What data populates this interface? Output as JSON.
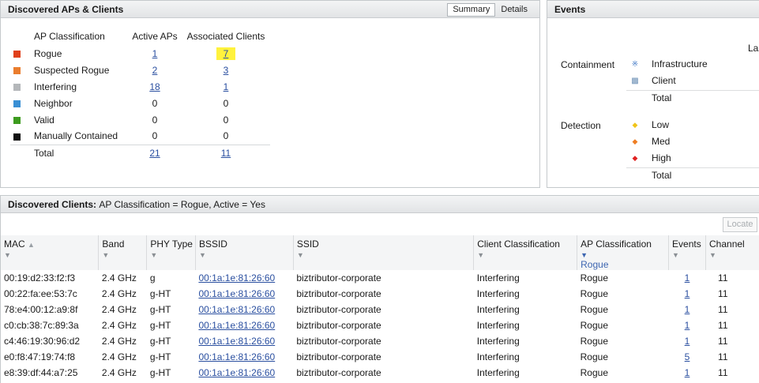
{
  "ap_panel": {
    "title": "Discovered APs & Clients",
    "tabs": [
      {
        "label": "Summary",
        "active": true
      },
      {
        "label": "Details",
        "active": false
      }
    ],
    "columns": [
      "AP Classification",
      "Active APs",
      "Associated Clients"
    ],
    "rows": [
      {
        "label": "Rogue",
        "color": "#e0401a",
        "active_aps": "1",
        "active_link": true,
        "clients": "7",
        "clients_link": true,
        "highlight": true
      },
      {
        "label": "Suspected Rogue",
        "color": "#ea7d2e",
        "active_aps": "2",
        "active_link": true,
        "clients": "3",
        "clients_link": true
      },
      {
        "label": "Interfering",
        "color": "#b4b7ba",
        "active_aps": "18",
        "active_link": true,
        "clients": "1",
        "clients_link": true
      },
      {
        "label": "Neighbor",
        "color": "#3a8fd4",
        "active_aps": "0",
        "active_link": false,
        "clients": "0",
        "clients_link": false
      },
      {
        "label": "Valid",
        "color": "#3d9b1f",
        "active_aps": "0",
        "active_link": false,
        "clients": "0",
        "clients_link": false
      },
      {
        "label": "Manually Contained",
        "color": "#111111",
        "active_aps": "0",
        "active_link": false,
        "clients": "0",
        "clients_link": false
      }
    ],
    "total": {
      "label": "Total",
      "active_aps": "21",
      "clients": "11"
    }
  },
  "events_panel": {
    "title": "Events",
    "truncated_header": "Las",
    "containment_label": "Containment",
    "containment_items": [
      {
        "label": "Infrastructure",
        "icon": "wireless-icon",
        "icon_color": "#4a7fc9"
      },
      {
        "label": "Client",
        "icon": "computer-icon",
        "icon_color": "#6b8fb5"
      },
      {
        "label": "Total"
      }
    ],
    "detection_label": "Detection",
    "detection_items": [
      {
        "label": "Low",
        "icon": "diamond-icon",
        "icon_color": "#f0c419"
      },
      {
        "label": "Med",
        "icon": "diamond-icon",
        "icon_color": "#ee7d22"
      },
      {
        "label": "High",
        "icon": "diamond-icon",
        "icon_color": "#e02222"
      },
      {
        "label": "Total"
      }
    ]
  },
  "clients_panel": {
    "title": "Discovered Clients:",
    "filter_text": "AP Classification = Rogue, Active = Yes",
    "locate_label": "Locate",
    "columns": [
      {
        "label": "MAC",
        "sorted": true
      },
      {
        "label": "Band"
      },
      {
        "label": "PHY Type"
      },
      {
        "label": "BSSID"
      },
      {
        "label": "SSID"
      },
      {
        "label": "Client Classification"
      },
      {
        "label": "AP Classification",
        "filter_value": "Rogue"
      },
      {
        "label": "Events"
      },
      {
        "label": "Channel"
      }
    ],
    "rows": [
      {
        "mac": "00:19:d2:33:f2:f3",
        "band": "2.4 GHz",
        "phy": "g",
        "bssid": "00:1a:1e:81:26:60",
        "ssid": "biztributor-corporate",
        "client_class": "Interfering",
        "ap_class": "Rogue",
        "events": "1",
        "channel": "11"
      },
      {
        "mac": "00:22:fa:ee:53:7c",
        "band": "2.4 GHz",
        "phy": "g-HT",
        "bssid": "00:1a:1e:81:26:60",
        "ssid": "biztributor-corporate",
        "client_class": "Interfering",
        "ap_class": "Rogue",
        "events": "1",
        "channel": "11"
      },
      {
        "mac": "78:e4:00:12:a9:8f",
        "band": "2.4 GHz",
        "phy": "g-HT",
        "bssid": "00:1a:1e:81:26:60",
        "ssid": "biztributor-corporate",
        "client_class": "Interfering",
        "ap_class": "Rogue",
        "events": "1",
        "channel": "11"
      },
      {
        "mac": "c0:cb:38:7c:89:3a",
        "band": "2.4 GHz",
        "phy": "g-HT",
        "bssid": "00:1a:1e:81:26:60",
        "ssid": "biztributor-corporate",
        "client_class": "Interfering",
        "ap_class": "Rogue",
        "events": "1",
        "channel": "11"
      },
      {
        "mac": "c4:46:19:30:96:d2",
        "band": "2.4 GHz",
        "phy": "g-HT",
        "bssid": "00:1a:1e:81:26:60",
        "ssid": "biztributor-corporate",
        "client_class": "Interfering",
        "ap_class": "Rogue",
        "events": "1",
        "channel": "11"
      },
      {
        "mac": "e0:f8:47:19:74:f8",
        "band": "2.4 GHz",
        "phy": "g-HT",
        "bssid": "00:1a:1e:81:26:60",
        "ssid": "biztributor-corporate",
        "client_class": "Interfering",
        "ap_class": "Rogue",
        "events": "5",
        "channel": "11"
      },
      {
        "mac": "e8:39:df:44:a7:25",
        "band": "2.4 GHz",
        "phy": "g-HT",
        "bssid": "00:1a:1e:81:26:60",
        "ssid": "biztributor-corporate",
        "client_class": "Interfering",
        "ap_class": "Rogue",
        "events": "1",
        "channel": "11"
      }
    ]
  }
}
